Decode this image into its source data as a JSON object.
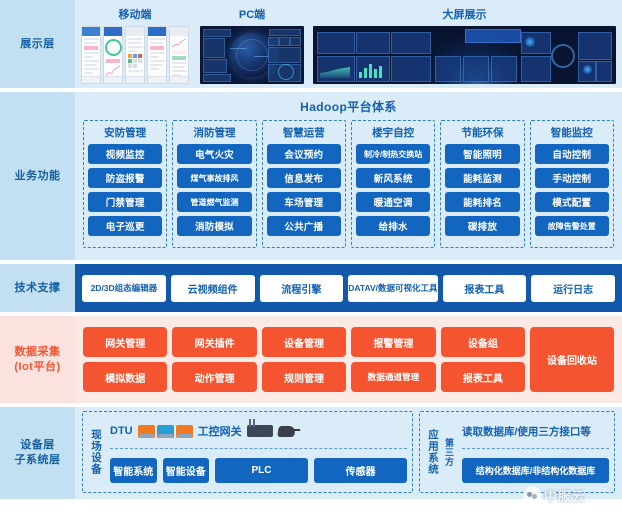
{
  "layers": {
    "presentation": {
      "label": "展示层",
      "items": [
        {
          "title": "移动端",
          "icon": "mobile-screenshots"
        },
        {
          "title": "PC端",
          "icon": "pc-dashboard-screenshot"
        },
        {
          "title": "大屏展示",
          "icon": "large-screen-dashboard"
        }
      ]
    },
    "business": {
      "label": "业务功能",
      "platform_title": "Hadoop平台体系",
      "columns": [
        {
          "title": "安防管理",
          "items": [
            "视频监控",
            "防盗报警",
            "门禁管理",
            "电子巡更"
          ]
        },
        {
          "title": "消防管理",
          "items": [
            "电气火灾",
            "煤气事故排风",
            "管道燃气监测",
            "消防模拟"
          ]
        },
        {
          "title": "智慧运营",
          "items": [
            "会议预约",
            "信息发布",
            "车场管理",
            "公共广播"
          ]
        },
        {
          "title": "楼宇自控",
          "items": [
            "制冷/制热交换站",
            "新风系统",
            "暖通空调",
            "给排水"
          ]
        },
        {
          "title": "节能环保",
          "items": [
            "智能照明",
            "能耗监测",
            "能耗排名",
            "碳排放"
          ]
        },
        {
          "title": "智能监控",
          "items": [
            "自动控制",
            "手动控制",
            "模式配置",
            "故障告警处置"
          ]
        }
      ]
    },
    "technical": {
      "label": "技术支撑",
      "items": [
        "2D/3D组态编辑器",
        "云视频组件",
        "流程引擎",
        "DATAV/数据可视化工具",
        "报表工具",
        "运行日志"
      ]
    },
    "data_acquisition": {
      "label_line1": "数据采集",
      "label_line2": "(Iot平台)",
      "columns": [
        [
          "网关管理",
          "模拟数据"
        ],
        [
          "网关插件",
          "动作管理"
        ],
        [
          "设备管理",
          "规则管理"
        ],
        [
          "报警管理",
          "数据通道管理"
        ],
        [
          "设备组",
          "报表工具"
        ]
      ],
      "tall_item": "设备回收站"
    },
    "device": {
      "label_line1": "设备层",
      "label_line2": "子系统层",
      "field": {
        "vertical_label": "现场设备",
        "top_labels": [
          "DTU",
          "工控网关"
        ],
        "pills": [
          "智能系统",
          "智能设备",
          "PLC",
          "传感器"
        ],
        "icons": [
          "dtu-device-icon",
          "industrial-gateway-icon",
          "sensor-icon"
        ]
      },
      "application": {
        "vertical_label_left": "应用系统",
        "vertical_label_right": "第三方",
        "top_label": "读取数据库/使用三方接口等",
        "db_pill": "结构化数据库/非结构化数据库"
      }
    }
  },
  "watermark": {
    "text": "中服云",
    "logo": "cloud-logo-icon"
  },
  "colors": {
    "layer_blue_bg": "#d9ecf8",
    "label_blue_bg": "#c3e0f2",
    "label_blue_text": "#14609f",
    "box_blue": "#1366c0",
    "tech_band": "#1259ab",
    "layer_red_bg": "#fbe9e5",
    "label_red_bg": "#fbe2de",
    "accent_red": "#f4542f",
    "dashed_border": "#2f7fc4"
  }
}
